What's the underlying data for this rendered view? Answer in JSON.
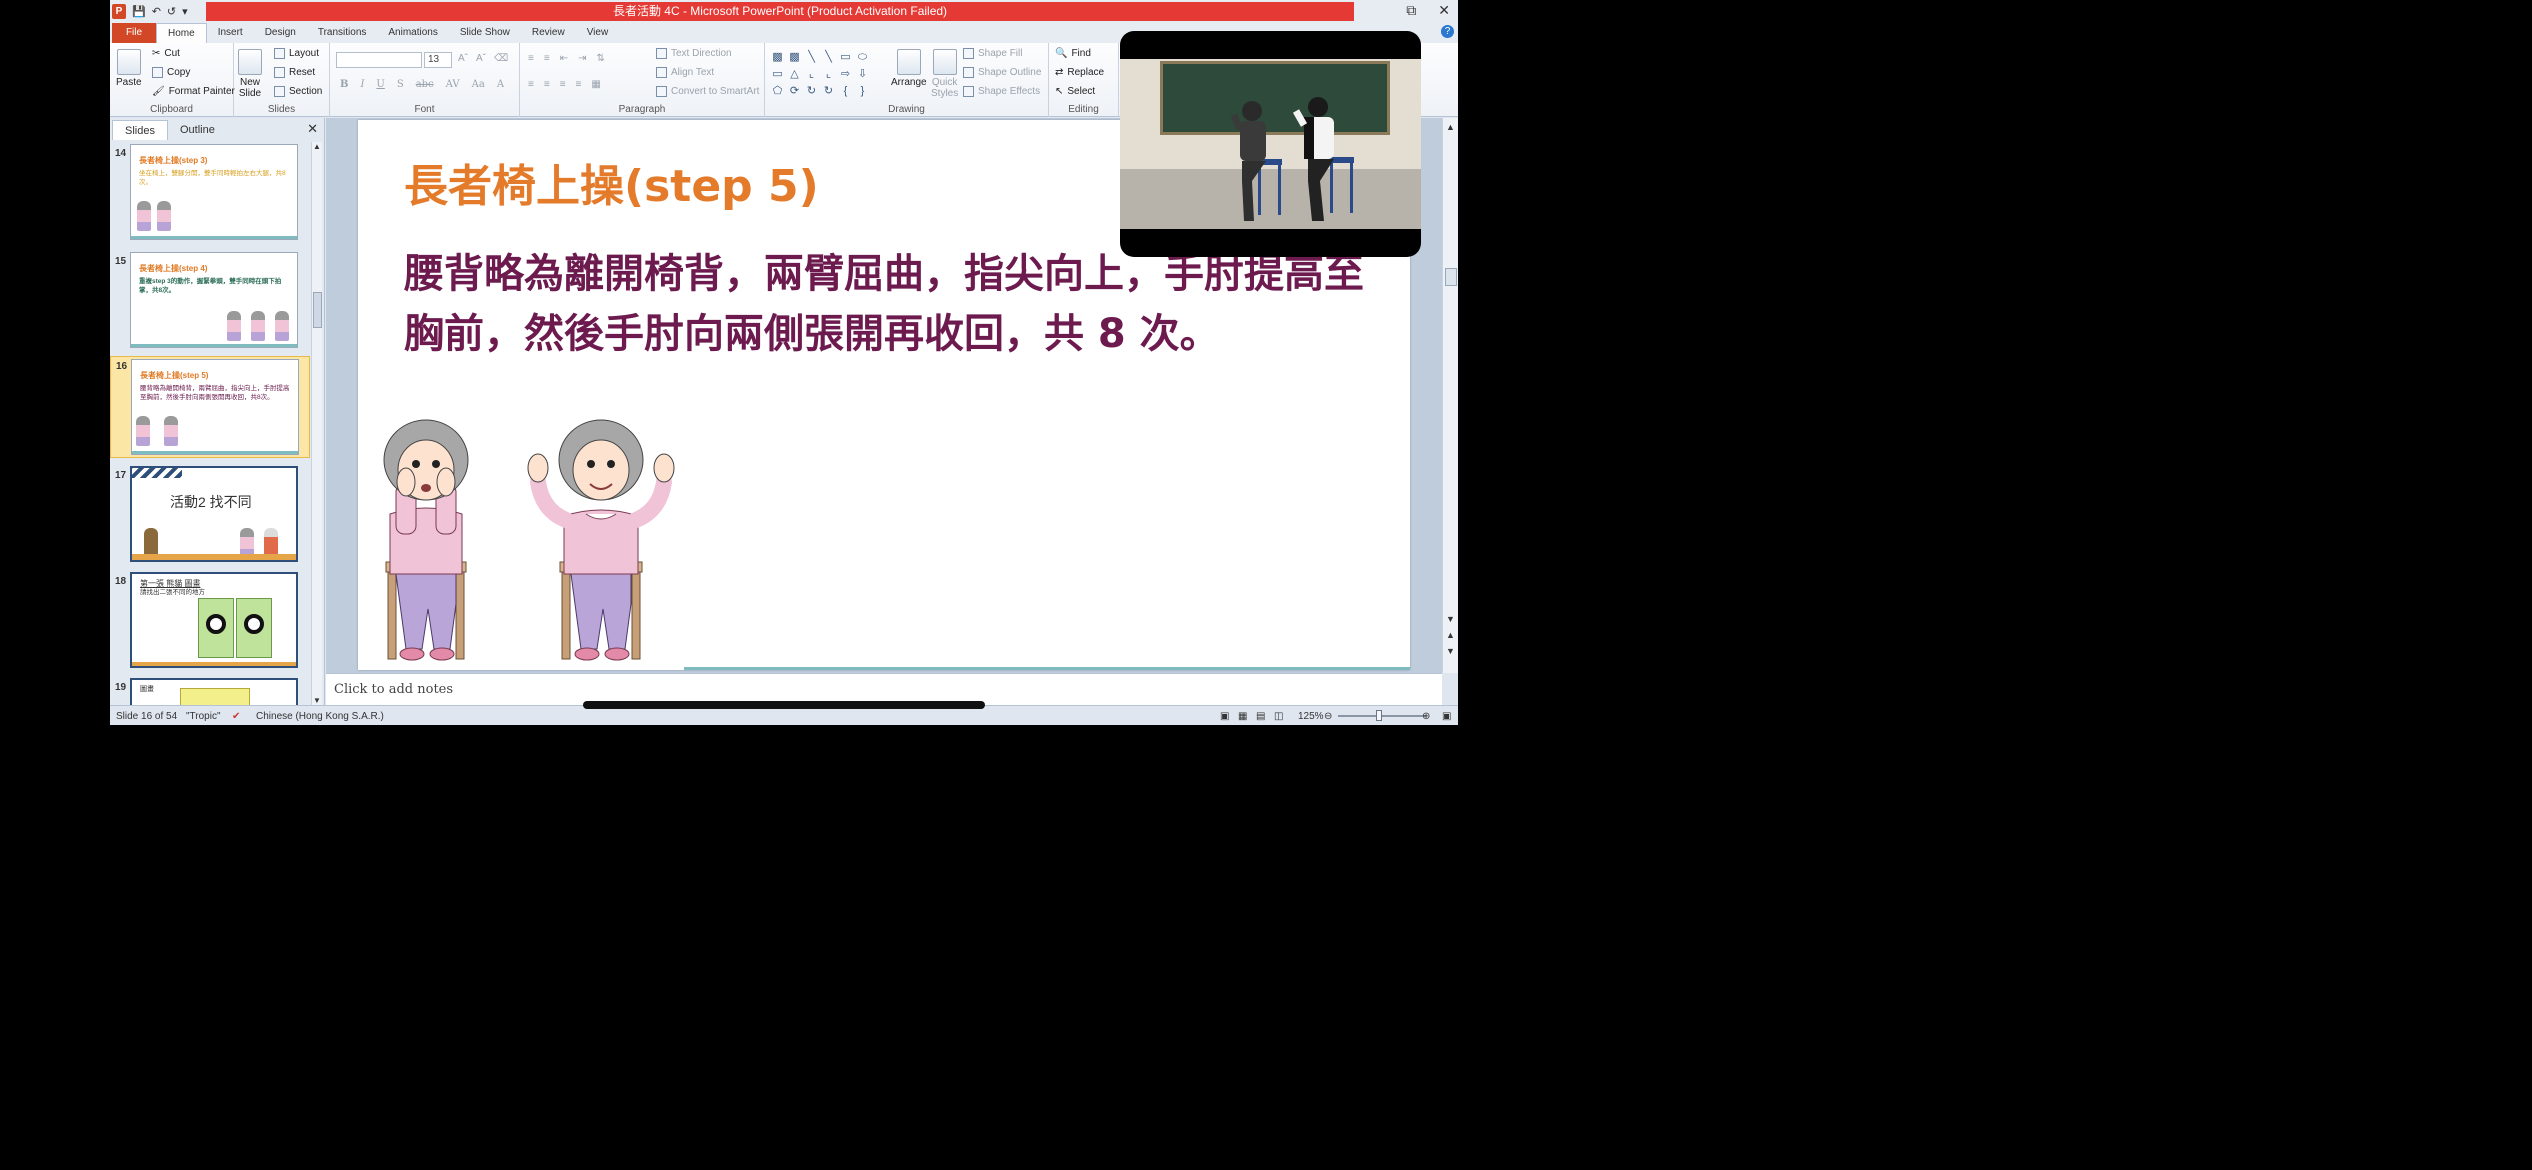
{
  "window": {
    "title": "長者活動 4C - Microsoft PowerPoint (Product Activation Failed)",
    "app_letter": "P",
    "controls": [
      "⧉",
      "✕"
    ]
  },
  "tabs": [
    "File",
    "Home",
    "Insert",
    "Design",
    "Transitions",
    "Animations",
    "Slide Show",
    "Review",
    "View"
  ],
  "ribbon": {
    "clipboard": {
      "label": "Clipboard",
      "paste": "Paste",
      "cut": "Cut",
      "copy": "Copy",
      "format_painter": "Format Painter"
    },
    "slides": {
      "label": "Slides",
      "new_slide": "New",
      "new_slide2": "Slide",
      "layout": "Layout",
      "reset": "Reset",
      "section": "Section"
    },
    "font": {
      "label": "Font",
      "size": "13"
    },
    "paragraph": {
      "label": "Paragraph",
      "text_direction": "Text Direction",
      "align_text": "Align Text",
      "convert": "Convert to SmartArt"
    },
    "drawing": {
      "label": "Drawing",
      "arrange": "Arrange",
      "quick_styles": "Quick",
      "quick_styles2": "Styles",
      "shape_fill": "Shape Fill",
      "shape_outline": "Shape Outline",
      "shape_effects": "Shape Effects"
    },
    "editing": {
      "label": "Editing",
      "find": "Find",
      "replace": "Replace",
      "select": "Select"
    }
  },
  "panel": {
    "tabs": [
      "Slides",
      "Outline"
    ],
    "close": "✕",
    "thumbnails": [
      {
        "num": "14",
        "title": "長者椅上操(step 3)",
        "body": "坐在椅上，雙腳分開，雙手同時輕拍左右大腿，共8次。"
      },
      {
        "num": "15",
        "title": "長者椅上操(step 4)",
        "body": "重複step 3的動作，握緊拳頭，雙手同時在頭下拍掌，共8次。"
      },
      {
        "num": "16",
        "title": "長者椅上操(step 5)",
        "body": "腰背略為離開椅背，兩臂屈曲，指尖向上，手肘提高至胸前，然後手肘向兩側張開再收回，共8次。"
      },
      {
        "num": "17",
        "title": "活動2 找不同",
        "body": ""
      },
      {
        "num": "18",
        "title": "第一張 熊貓 圖畫",
        "body": "請找出二張不同的地方"
      },
      {
        "num": "19",
        "title": "圖畫",
        "body": ""
      }
    ]
  },
  "slide": {
    "title": "長者椅上操(step 5)",
    "body": "腰背略為離開椅背，兩臂屈曲，指尖向上，手肘提高至胸前，然後手肘向兩側張開再收回，共 8 次。"
  },
  "notes": {
    "placeholder": "Click to add notes"
  },
  "status": {
    "slide_info": "Slide 16 of 54",
    "theme": "\"Tropic\"",
    "language": "Chinese (Hong Kong S.A.R.)",
    "zoom": "125%"
  },
  "colors": {
    "title_orange": "#e37b2b",
    "body_maroon": "#6d1b4f",
    "file_tab": "#d24726",
    "activation_bar": "#e53935"
  }
}
